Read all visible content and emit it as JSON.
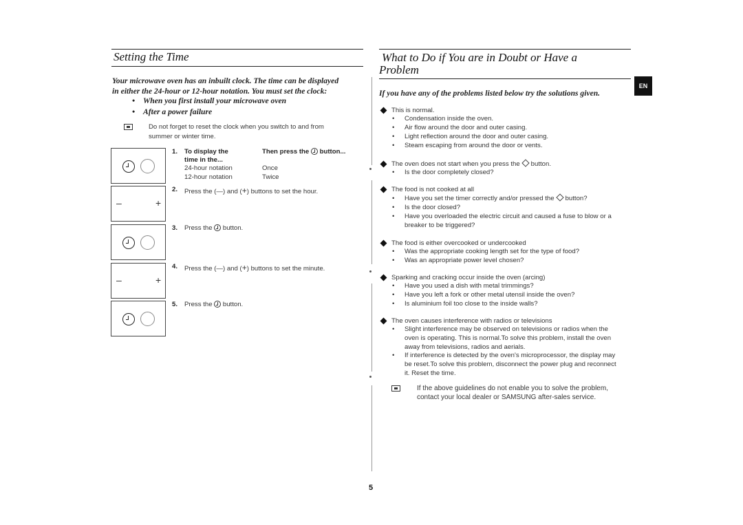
{
  "left": {
    "title": "Setting the Time",
    "intro_line1": "Your microwave oven has an inbuilt clock. The time can be displayed",
    "intro_line2": "in either the 24-hour or 12-hour notation. You must set the clock:",
    "conditions": [
      "When you first install your microwave oven",
      "After a power failure"
    ],
    "note_line1": "Do not forget to reset the clock when you switch to and from",
    "note_line2": "summer or winter time.",
    "steps": {
      "s1": {
        "num": "1.",
        "col1_head1": "To display the",
        "col1_head2": "time in the...",
        "col2_head_pre": "Then press the",
        "col2_head_post": "button...",
        "rows": [
          {
            "notation": "24-hour notation",
            "presses": "Once"
          },
          {
            "notation": "12-hour notation",
            "presses": "Twice"
          }
        ]
      },
      "s2": {
        "num": "2.",
        "pre": "Press the (",
        "minus": "—",
        "mid": ") and (",
        "plus": "+",
        "post": ") buttons to set the hour."
      },
      "s3": {
        "num": "3.",
        "pre": "Press the",
        "post": "button."
      },
      "s4": {
        "num": "4.",
        "pre": "Press the (",
        "minus": "—",
        "mid": ") and (",
        "plus": "+",
        "post": ") buttons to set the minute."
      },
      "s5": {
        "num": "5.",
        "pre": "Press the",
        "post": "button."
      }
    },
    "panel_minus": "–",
    "panel_plus": "+"
  },
  "right": {
    "title_line1": "What to Do if You are in Doubt or Have a",
    "title_line2": "Problem",
    "intro": "If you have any of the problems listed below try the solutions given.",
    "lang_badge": "EN",
    "problems": [
      {
        "heading": "This is normal.",
        "items": [
          "Condensation inside the oven.",
          "Air flow around the door and outer casing.",
          "Light reflection around the door and outer casing.",
          "Steam escaping from around the door or vents."
        ]
      },
      {
        "heading_pre": "The oven does not start when you press the",
        "heading_post": "button.",
        "items": [
          "Is the door completely closed?"
        ]
      },
      {
        "heading": "The food is not cooked at all",
        "items_1_pre": "Have you set the timer correctly and/or pressed the",
        "items_1_post": "button?",
        "items": [
          "Is the door closed?",
          "Have you overloaded the electric circuit and caused a fuse to blow or a",
          "breaker to be triggered?"
        ]
      },
      {
        "heading": "The food is either overcooked or undercooked",
        "items": [
          "Was the appropriate cooking length set for the type of food?",
          "Was an appropriate power level chosen?"
        ]
      },
      {
        "heading": "Sparking and cracking occur inside the oven (arcing)",
        "items": [
          "Have you used a dish with metal trimmings?",
          "Have you left a fork or other metal utensil inside the oven?",
          "Is aluminium foil too close to the inside walls?"
        ]
      },
      {
        "heading": "The oven causes interference with radios or televisions",
        "items": [
          "Slight interference may be observed on televisions or radios when the",
          "oven is operating. This is normal.To solve this problem, install the oven",
          "away from televisions, radios and aerials.",
          "If interference is detected by the oven's microprocessor, the display may",
          "be reset.To solve this problem, disconnect the power plug and reconnect",
          "it. Reset the time."
        ]
      }
    ],
    "note_line1": "If the above guidelines do not enable you to solve the problem,",
    "note_line2": "contact your local dealer or SAMSUNG after-sales service."
  },
  "footer": {
    "page_number": "5"
  },
  "bullet_char": "•"
}
